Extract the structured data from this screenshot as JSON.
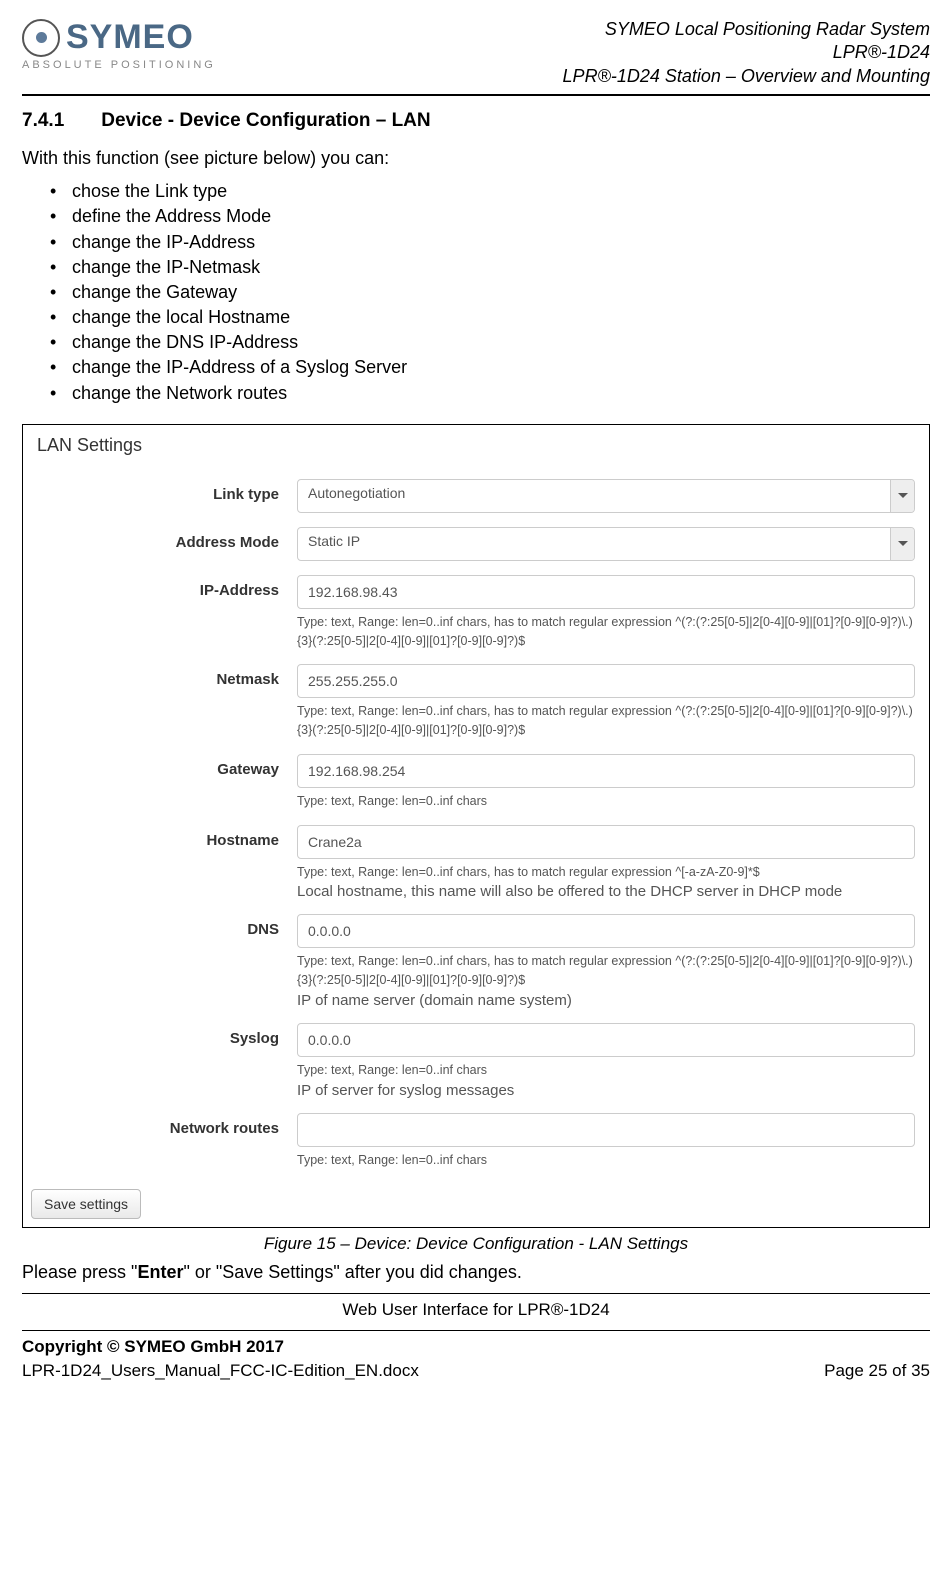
{
  "header": {
    "logo_name": "SYMEO",
    "logo_sub": "ABSOLUTE POSITIONING",
    "right_line1": "SYMEO Local Positioning Radar System",
    "right_line2": "LPR®-1D24",
    "right_line3": "LPR®-1D24 Station – Overview and Mounting"
  },
  "section": {
    "number": "7.4.1",
    "title": "Device - Device Configuration – LAN",
    "intro": "With this function (see picture below) you can:",
    "bullets": [
      "chose the Link type",
      "define the Address Mode",
      "change the IP-Address",
      "change the IP-Netmask",
      "change the Gateway",
      "change the local Hostname",
      "change the DNS IP-Address",
      "change the IP-Address of a Syslog Server",
      "change the Network routes"
    ]
  },
  "panel": {
    "title": "LAN Settings",
    "fields": {
      "link_type": {
        "label": "Link type",
        "value": "Autonegotiation"
      },
      "address_mode": {
        "label": "Address Mode",
        "value": "Static IP"
      },
      "ip_address": {
        "label": "IP-Address",
        "value": "192.168.98.43",
        "hint": "Type: text, Range: len=0..inf chars, has to match regular expression ^(?:(?:25[0-5]|2[0-4][0-9]|[01]?[0-9][0-9]?)\\.){3}(?:25[0-5]|2[0-4][0-9]|[01]?[0-9][0-9]?)$"
      },
      "netmask": {
        "label": "Netmask",
        "value": "255.255.255.0",
        "hint": "Type: text, Range: len=0..inf chars, has to match regular expression ^(?:(?:25[0-5]|2[0-4][0-9]|[01]?[0-9][0-9]?)\\.){3}(?:25[0-5]|2[0-4][0-9]|[01]?[0-9][0-9]?)$"
      },
      "gateway": {
        "label": "Gateway",
        "value": "192.168.98.254",
        "hint": "Type: text, Range: len=0..inf chars"
      },
      "hostname": {
        "label": "Hostname",
        "value": "Crane2a",
        "hint": "Type: text, Range: len=0..inf chars, has to match regular expression ^[-a-zA-Z0-9]*$",
        "desc": "Local hostname, this name will also be offered to the DHCP server in DHCP mode"
      },
      "dns": {
        "label": "DNS",
        "value": "0.0.0.0",
        "hint": "Type: text, Range: len=0..inf chars, has to match regular expression ^(?:(?:25[0-5]|2[0-4][0-9]|[01]?[0-9][0-9]?)\\.){3}(?:25[0-5]|2[0-4][0-9]|[01]?[0-9][0-9]?)$",
        "desc": "IP of name server (domain name system)"
      },
      "syslog": {
        "label": "Syslog",
        "value": "0.0.0.0",
        "hint": "Type: text, Range: len=0..inf chars",
        "desc": "IP of server for syslog messages"
      },
      "network_routes": {
        "label": "Network routes",
        "value": "",
        "hint": "Type: text, Range: len=0..inf chars"
      }
    },
    "save_label": "Save settings"
  },
  "figcaption": "Figure 15 – Device: Device Configuration - LAN Settings",
  "after_fig_pre": "Please press \"",
  "after_fig_bold": "Enter",
  "after_fig_post": "\" or \"Save Settings\" after you did changes.",
  "footer": {
    "center": "Web User Interface for LPR®-1D24",
    "copyright": "Copyright © SYMEO GmbH 2017",
    "filename": "LPR-1D24_Users_Manual_FCC-IC-Edition_EN.docx",
    "page": "Page 25 of 35"
  }
}
